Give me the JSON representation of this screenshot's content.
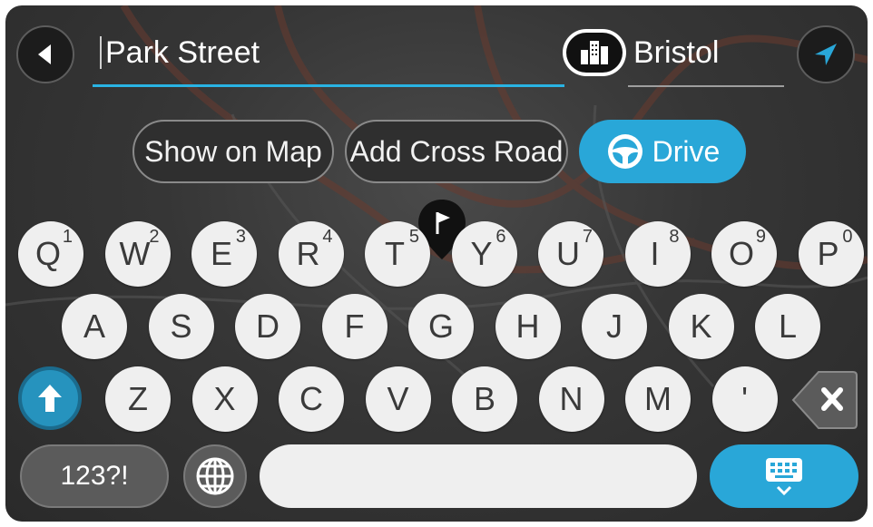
{
  "search": {
    "value": "Park Street"
  },
  "city": {
    "value": "Bristol"
  },
  "actions": {
    "show_on_map": "Show on Map",
    "add_cross_road": "Add Cross Road",
    "drive": "Drive"
  },
  "keyboard": {
    "row1": [
      {
        "ch": "Q",
        "num": "1"
      },
      {
        "ch": "W",
        "num": "2"
      },
      {
        "ch": "E",
        "num": "3"
      },
      {
        "ch": "R",
        "num": "4"
      },
      {
        "ch": "T",
        "num": "5"
      },
      {
        "ch": "Y",
        "num": "6"
      },
      {
        "ch": "U",
        "num": "7"
      },
      {
        "ch": "I",
        "num": "8"
      },
      {
        "ch": "O",
        "num": "9"
      },
      {
        "ch": "P",
        "num": "0"
      }
    ],
    "row2": [
      "A",
      "S",
      "D",
      "F",
      "G",
      "H",
      "J",
      "K",
      "L"
    ],
    "row3": [
      "Z",
      "X",
      "C",
      "V",
      "B",
      "N",
      "M",
      "'"
    ],
    "numbers_label": "123?!"
  },
  "icons": {
    "back": "back-arrow-icon",
    "city": "city-buildings-icon",
    "locate": "navigation-arrow-icon",
    "drive": "steering-wheel-icon",
    "shift": "shift-arrow-icon",
    "backspace": "backspace-icon",
    "language": "globe-icon",
    "hide_keyboard": "keyboard-hide-icon",
    "map_pin": "flag-pin-icon"
  },
  "colors": {
    "accent": "#29a7d8",
    "background": "#363636",
    "key": "#efefef"
  }
}
